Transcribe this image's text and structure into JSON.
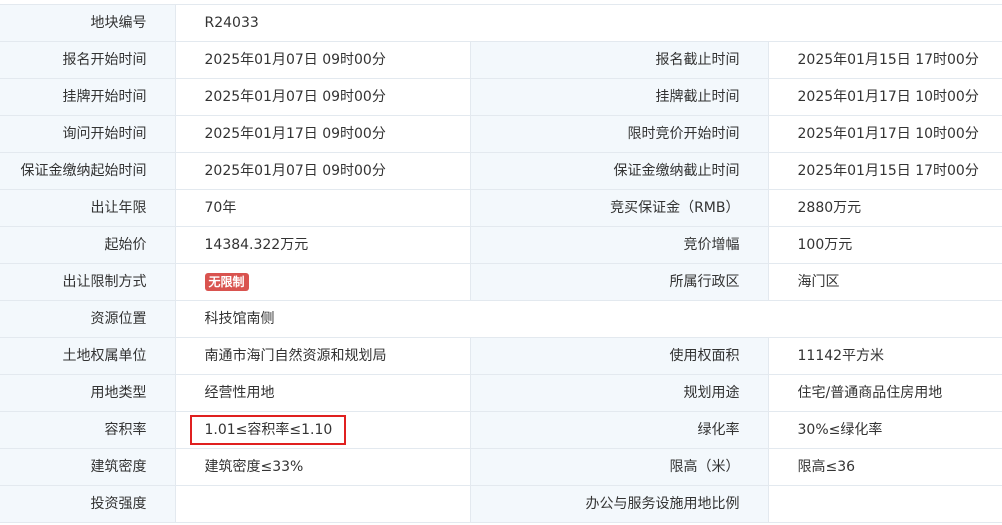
{
  "rows": [
    {
      "l1": "地块编号",
      "v1": "R24033",
      "l2": "",
      "v2": ""
    },
    {
      "l1": "报名开始时间",
      "v1": "2025年01月07日 09时00分",
      "l2": "报名截止时间",
      "v2": "2025年01月15日 17时00分"
    },
    {
      "l1": "挂牌开始时间",
      "v1": "2025年01月07日 09时00分",
      "l2": "挂牌截止时间",
      "v2": "2025年01月17日 10时00分"
    },
    {
      "l1": "询问开始时间",
      "v1": "2025年01月17日 09时00分",
      "l2": "限时竞价开始时间",
      "v2": "2025年01月17日 10时00分"
    },
    {
      "l1": "保证金缴纳起始时间",
      "v1": "2025年01月07日 09时00分",
      "l2": "保证金缴纳截止时间",
      "v2": "2025年01月15日 17时00分"
    },
    {
      "l1": "出让年限",
      "v1": "70年",
      "l2": "竞买保证金（RMB）",
      "v2": "2880万元"
    },
    {
      "l1": "起始价",
      "v1": "14384.322万元",
      "l2": "竞价增幅",
      "v2": "100万元"
    },
    {
      "l1": "出让限制方式",
      "v1": "无限制",
      "l2": "所属行政区",
      "v2": "海门区"
    },
    {
      "l1": "资源位置",
      "v1": "科技馆南侧",
      "l2": "",
      "v2": ""
    },
    {
      "l1": "土地权属单位",
      "v1": "南通市海门自然资源和规划局",
      "l2": "使用权面积",
      "v2": "11142平方米"
    },
    {
      "l1": "用地类型",
      "v1": "经营性用地",
      "l2": "规划用途",
      "v2": "住宅/普通商品住房用地"
    },
    {
      "l1": "容积率",
      "v1": "1.01≤容积率≤1.10",
      "l2": "绿化率",
      "v2": "30%≤绿化率"
    },
    {
      "l1": "建筑密度",
      "v1": "建筑密度≤33%",
      "l2": "限高（米）",
      "v2": "限高≤36"
    },
    {
      "l1": "投资强度",
      "v1": "",
      "l2": "办公与服务设施用地比例",
      "v2": ""
    }
  ],
  "colors": {
    "label_bg": "#f3f8fc",
    "border": "#e3e9ef",
    "badge": "#d9534f",
    "highlight": "#e02020"
  }
}
